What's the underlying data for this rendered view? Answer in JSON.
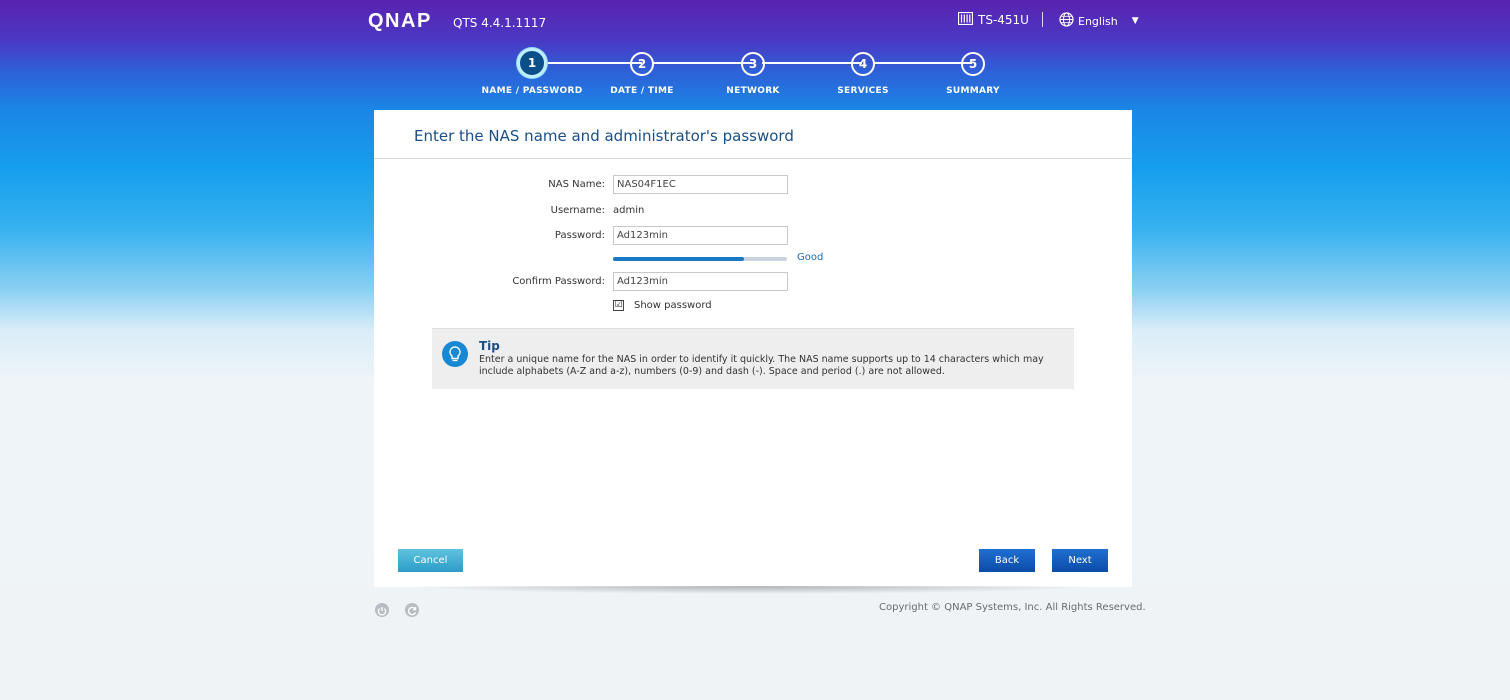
{
  "header": {
    "logo_text": "QNAP",
    "version": "QTS 4.4.1.1117",
    "device_icon": "nas-device-icon",
    "device_name": "TS-451U",
    "language_icon": "globe-icon",
    "language": "English"
  },
  "steps": [
    {
      "number": "1",
      "label": "NAME / PASSWORD",
      "active": true
    },
    {
      "number": "2",
      "label": "DATE / TIME",
      "active": false
    },
    {
      "number": "3",
      "label": "NETWORK",
      "active": false
    },
    {
      "number": "4",
      "label": "SERVICES",
      "active": false
    },
    {
      "number": "5",
      "label": "SUMMARY",
      "active": false
    }
  ],
  "form": {
    "title": "Enter the NAS name and administrator's password",
    "nas_name_label": "NAS Name:",
    "nas_name_value": "NAS04F1EC",
    "username_label": "Username:",
    "username_value": "admin",
    "password_label": "Password:",
    "password_value": "Ad123min",
    "strength_text": "Good",
    "strength_fraction": 0.75,
    "confirm_label": "Confirm Password:",
    "confirm_value": "Ad123min",
    "show_password_label": "Show password",
    "show_password_checked": true,
    "checkbox_glyph": "☑"
  },
  "tip": {
    "icon": "lightbulb-icon",
    "title": "Tip",
    "text": "Enter a unique name for the NAS in order to identify it quickly. The NAS name supports up to 14 characters which may include alphabets (A-Z and a-z), numbers (0-9) and dash (-). Space and period (.) are not allowed."
  },
  "buttons": {
    "cancel": "Cancel",
    "back": "Back",
    "next": "Next"
  },
  "footer": {
    "power_icon": "power-icon",
    "restart_icon": "restart-icon",
    "copyright": "Copyright © QNAP Systems, Inc. All Rights Reserved."
  },
  "colors": {
    "accent": "#1a78c4",
    "title": "#1a4f86"
  }
}
